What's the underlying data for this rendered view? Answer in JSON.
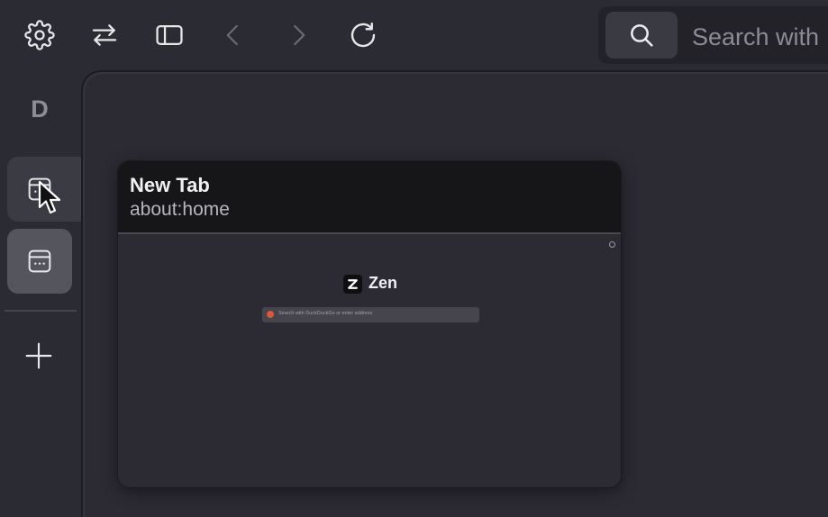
{
  "toolbar": {
    "buttons": [
      {
        "name": "settings",
        "icon": "gear-icon"
      },
      {
        "name": "swap",
        "icon": "arrows-swap-icon"
      },
      {
        "name": "sidebar-toggle",
        "icon": "sidebar-icon"
      },
      {
        "name": "back",
        "icon": "chevron-left-icon",
        "enabled": false
      },
      {
        "name": "forward",
        "icon": "chevron-right-icon",
        "enabled": false
      },
      {
        "name": "reload",
        "icon": "reload-icon"
      }
    ]
  },
  "urlbar": {
    "placeholder": "Search with",
    "icon": "search-icon"
  },
  "sidebar": {
    "workspace_letter": "D",
    "tabs": [
      {
        "icon": "tab-page-icon",
        "state": "hovered"
      },
      {
        "icon": "tab-page-icon",
        "state": "active"
      }
    ],
    "new_tab_icon": "plus-icon"
  },
  "tab_preview": {
    "title": "New Tab",
    "url": "about:home",
    "page": {
      "brand": "Zen",
      "search_placeholder": "Search with DuckDuckGo or enter address"
    }
  },
  "colors": {
    "background": "#2b2b33",
    "preview_header": "#161618",
    "active_tab": "#55555d",
    "hover_tab": "#3b3b43",
    "duckduckgo": "#de5833"
  }
}
